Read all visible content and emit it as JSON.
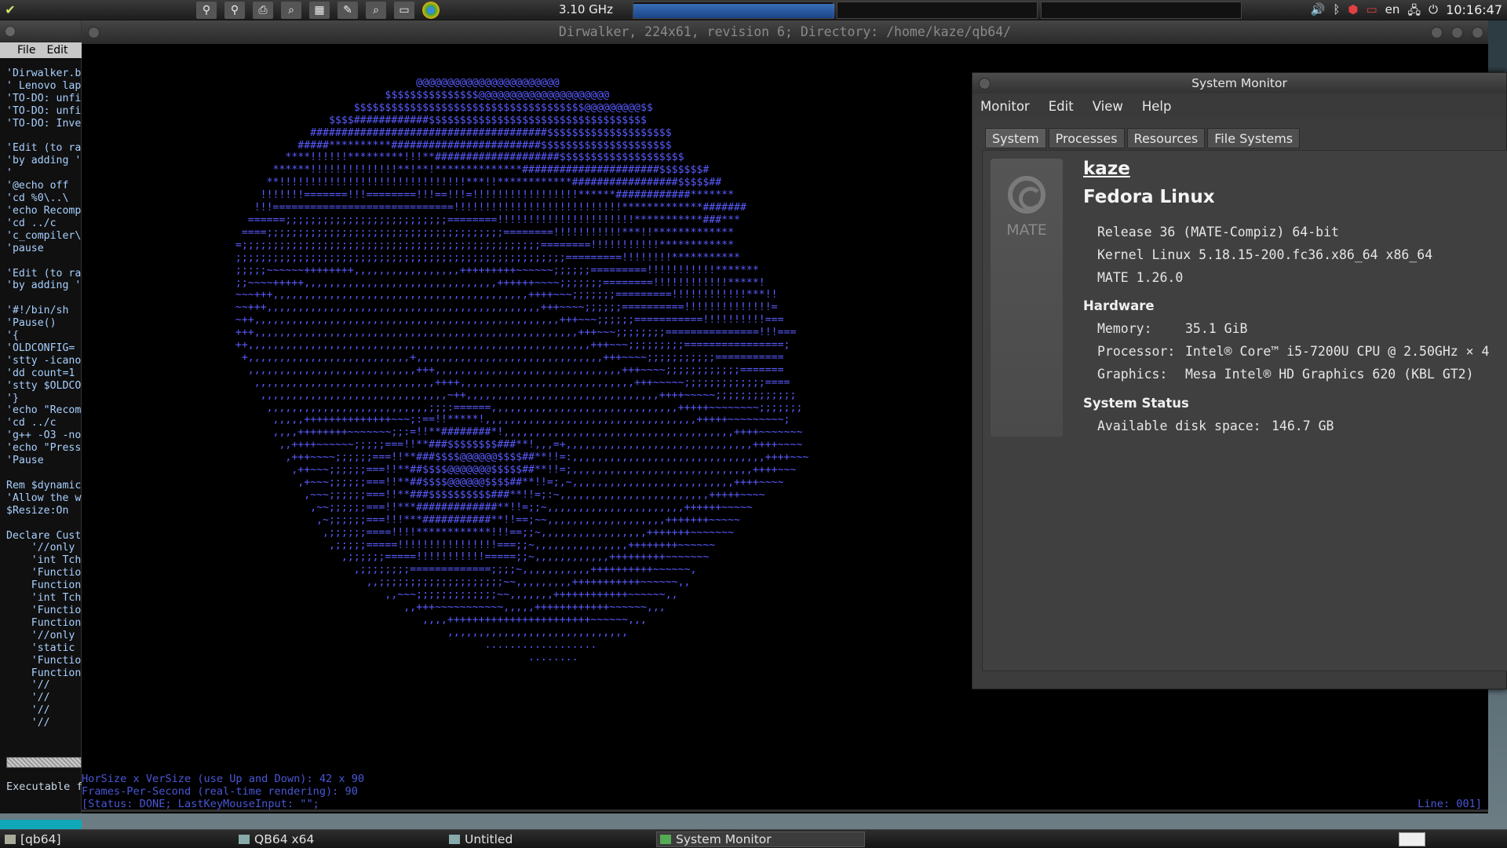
{
  "top_panel": {
    "cpufreq": "3.10 GHz",
    "language": "en",
    "clock": "10:16:47",
    "launcher_icons": [
      "network-icon",
      "network-icon",
      "printer-icon",
      "search-icon",
      "calculator-icon",
      "text-editor-icon",
      "search-icon",
      "terminal-icon",
      "chrome-icon"
    ],
    "tray_icons": [
      "volume-icon",
      "bluetooth-icon",
      "package-icon",
      "battery-icon",
      "language-indicator",
      "network-icon",
      "power-icon"
    ]
  },
  "left_window": {
    "menu_file": "File",
    "menu_edit": "Edit",
    "code": "'Dirwalker.b\n' Lenovo lap\n'TO-DO: unfi\n'TO-DO: unfi\n'TO-DO: Inve\n\n'Edit (to ra\n'by adding '\n'\n'@echo off\n'cd %0\\..\\\n'echo Recomp\n'cd ../c\n'c_compiler\\\n'pause\n\n'Edit (to ra\n'by adding '\n\n'#!/bin/sh\n'Pause()\n'{\n'OLDCONFIG=\n'stty -icano\n'dd count=1\n'stty $OLDCO\n'}\n'echo \"Recom\n'cd ../c\n'g++ -O3 -no\n'echo \"Press\n'Pause\n\nRem $dynamic\n'Allow the w\n$Resize:On\n\nDeclare Cust\n    '//only\n    'int Tch\n    'Functio\n    Function\n    'int Tch\n    'Functio\n    Function\n    '//only\n    'static\n    'Functio\n    Function\n    '//\n    '//\n    '//\n    '//",
    "status": "Executable f"
  },
  "main_window": {
    "title": "Dirwalker, 224x61, revision 6; Directory: /home/kaze/qb64/",
    "ascii_art": "                               @@@@@@@@@@@@@@@@@@@@@@@\n                          $$$$$$$$$$$$$$$@@@@@@@@@@@@@@@@@@@@@\n                     $$$$$$$$$$$$$$$$$$$$$$$$$$$$$$$$$$$$$@@@@@@@@@$$\n                 $$$$############$$$$$$$$$$$$$$$$$$$$$$$$$$$$$$$$$$$\n              ######################################$$$$$$$$$$$$$$$$$$$$\n            #####**********########################$$$$$$$$$$$$$$$$$$$$$\n          ****!!!!!!*********!!!**####################$$$$$$$$$$$$$$$$$$$$\n        ******!!!!!!!!!!!!!!**!**!**************######################$$$$$$$#\n       **!!!!!!!!!!!!!!!!!!!!!!!!!!!!!!***!!************#################$$$$$##\n      !!!!!!!=======!!!========!!!==!!!=!!!!!!!!!!!!!!!!!******############*******\n     !!!=============================!!!!!!!!!!!!!!!!!!!!!!!!!!!*************#######\n    ======;;;;;;;;;;;;;;;;;;;;;;;;;;========!!!!!!!!!!!!!!!!!!!!!!***********###***\n   ====;;;;;;;;;;;;;;;;;;;;;;;;;;;;;;;;;;;;;;========!!!!!!!!!!!***!!*************\n  =;;;;;;;;;;;;;;;;;;;;;;;;;;;;;;;;;;;;;;;;;;;;;;;;========!!!!!!!!!!!************\n  ;;;;;;;;;;;;;;;;;;;;;;;;;;;;;;;;;;;;;;;;;;;;;;;;;;;;;=========!!!!!!!!***********\n  ;;;;;~~~~~~++++++++,,,,,,,,,,,,,,,,,+++++++++~~~~~~;;;;;;=========!!!!!!!!!!!*******\n  ;;~~~~+++++,,,,,,,,,,,,,,,,,,,,,,,,,,,,,,,++++++~~~~;;;;;;;========!!!!!!!!!!!!*****!\n  ~~~+++,,,,,,,,,,,,,,,,,,,,,,,,,,,,,,,,,,,,,,,,,++++~~~;;;;;;;=========!!!!!!!!!!!!***!!\n  ~~+++,,,,,,,,,,,,,,,,,,,,,,,,,,,,,,,,,,,,,,,,,,,,+++~~~~;;;;;;==========!!!!!!!!!!!!!!=\n  ~++,,,,,,,,,,,,,,,,,,,,,,,,,,,,,,,,,,,,,,,,,,,,,,,,,+++~~~;;;;;;===========!!!!!!!!!!===\n  +++,,,,,,,,,,,,,,,,,,,,,,,,,,,,,,,,,,,,,,,,,,,,,,,,,,,,+++~~~;;;;;;;;===============!!!===\n  ++,,,,,,,,,,,,,,,,,,,,,,,,,,,,,,,,,,,,,,,,,,,,,,,,,,,,,,,+++~~~;;;;;;;;;================;\n   +,,,,,,,,,,,,,,,,,,,,,,,,,,+,,,,,,,,,,,,,,,,,,,,,,,,,,,,,,+++~~~~;;;;;;;;;;;===========\n    ,,,,,,,,,,,,,,,,,,,,,,,,,,,+++,,,,,,,,,,,,,,,,,,,,,,,,,,,,,,+++~~~~;;;;;;;;;;;;=======\n     ,,,,,,,,,,,,,,,,,,,,,,,,,,,,,++++,,,,,,,,,,,,,,,,,,,,,,,,,,,,+++~~~~~;;;;;;;;;;;;;====\n      ,,,,,,,,,,,,,,,,,,,,,,,,,,,,,,~++,,,,,,,,,,,,,,,,,,,,,,,,,,,,,,,++++~~~~~;;;;;;;;;;;;;\n       ,,,,,,,,,,,,,,,,,,,,,,,,,,;;;:======,,,,,,,,,,,,,,,,,,,,,,,,,,,,,,+++++~~~~~~~~;;;;;;;\n        ,,,,,++++++++++++++~~~;:==!!*****!,,,,,,,,,,,,,,,,,,,,,,,,,,,,,,,,,,+++++~~~~~~~~~;\n        ,,,,++++++++~~~~~~~;;:=!!**########*!,,,,,,,,,,,,,,,,,,,,,,,,,,,,,,,,,,,,,++++~~~~~~~\n         ,,++++~~~~~~;;;;;===!!**###$$$$$$$$###**!,,,=+,,,,,,,,,,,,,,,,,,,,,,,,,,,,,,++++~~~~\n          ,+++~~~~;;;;;;===!!**###$$$$@@@@@@$$$$##**!!=:,,,,,,,,,,,,,,,,,,,,,,,,,,,,,,,++++~~~\n           ,++~~~;;;;;;===!!**##$$$$@@@@@@@$$$$$##**!!=;,,,,,,,,,,,,,,,,,,,,,,,,,,,,,++++~~~\n            ,+~~~;;;;;;===!!**##$$$$@@@@@@$$$$##**!!=;,~,,,,,,,,,,,,,,,,,,,,,,,,,,++++~~~~\n             ,~~~;;;;;;===!!**###$$$$$$$$$$###**!!=;:~,,,,,,,,,,,,,,,,,,,,,,,,+++++~~~~\n              ,~~;;;;;;===!!***#############**!!=;;~,,,,,,,,,,,,,,,,,,,,,,++++++~~~~~\n               ,~;;;;;;===!!!***###########**!!==;~~,,,,,,,,,,,,,,,,,,,+++++++~~~~~\n                ,;;;;;;====!!!!************!!!==;;~,,,,,,,,,,,,,,,,,+++++++~~~~~~~\n                 ,;;;;;=====!!!!!!!!!!!!!!!!===;;~,,,,,,,,,,,,,,,++++++++~~~~~~\n                   ,;;;;;;=====!!!!!!!!!!!=====;;~,,,,,,,,,,,,+++++++++~~~~~~~\n                     ,;;;;;;;;=============;;;;~,,,,,,,,,,,++++++++++~~~~~~,\n                       ,,;;;;;;;;;;;;;;;;;;;;~~,,,,,,,,,+++++++++++~~~~~~,,\n                          ,,~~~;;;;;;;;;;;;;~~,,,,,,,++++++++++++~~~~~~,,\n                             ,,+++~~~~~~~~~~~,,,,,++++++++++++~~~~~~,,,\n                                ,,,,+++++++++++++++++++++++~~~~~~,,,\n                                    ,,,,,,,,,,,,,,,,,,,,,,,,,,,,,\n                                          ..................\n                                                 ........",
    "info_line1": "HorSize x VerSize (use Up and Down): 42 x 90",
    "info_line2": "Frames-Per-Second (real-time rendering): 90",
    "info_line3": "[Status: DONE; LastKeyMouseInput: \"\";",
    "line_indicator": "Line: 001]"
  },
  "system_monitor": {
    "title": "System Monitor",
    "menu": [
      "Monitor",
      "Edit",
      "View",
      "Help"
    ],
    "tabs": [
      "System",
      "Processes",
      "Resources",
      "File Systems"
    ],
    "active_tab": "System",
    "logo_text": "MATE",
    "hostname": "kaze",
    "os_name": "Fedora Linux",
    "release": "Release 36 (MATE-Compiz) 64-bit",
    "kernel": "Kernel Linux 5.18.15-200.fc36.x86_64 x86_64",
    "mate_version": "MATE 1.26.0",
    "hardware_heading": "Hardware",
    "memory_label": "Memory:",
    "memory_value": "35.1 GiB",
    "processor_label": "Processor:",
    "processor_value": "Intel® Core™ i5-7200U CPU @ 2.50GHz × 4",
    "graphics_label": "Graphics:",
    "graphics_value": "Mesa Intel® HD Graphics 620 (KBL GT2)",
    "status_heading": "System Status",
    "disk_label": "Available disk space:",
    "disk_value": "146.7 GB"
  },
  "taskbar": {
    "items": [
      "[qb64]",
      "QB64 x64",
      "Untitled",
      "System Monitor"
    ],
    "active_item": "System Monitor"
  }
}
